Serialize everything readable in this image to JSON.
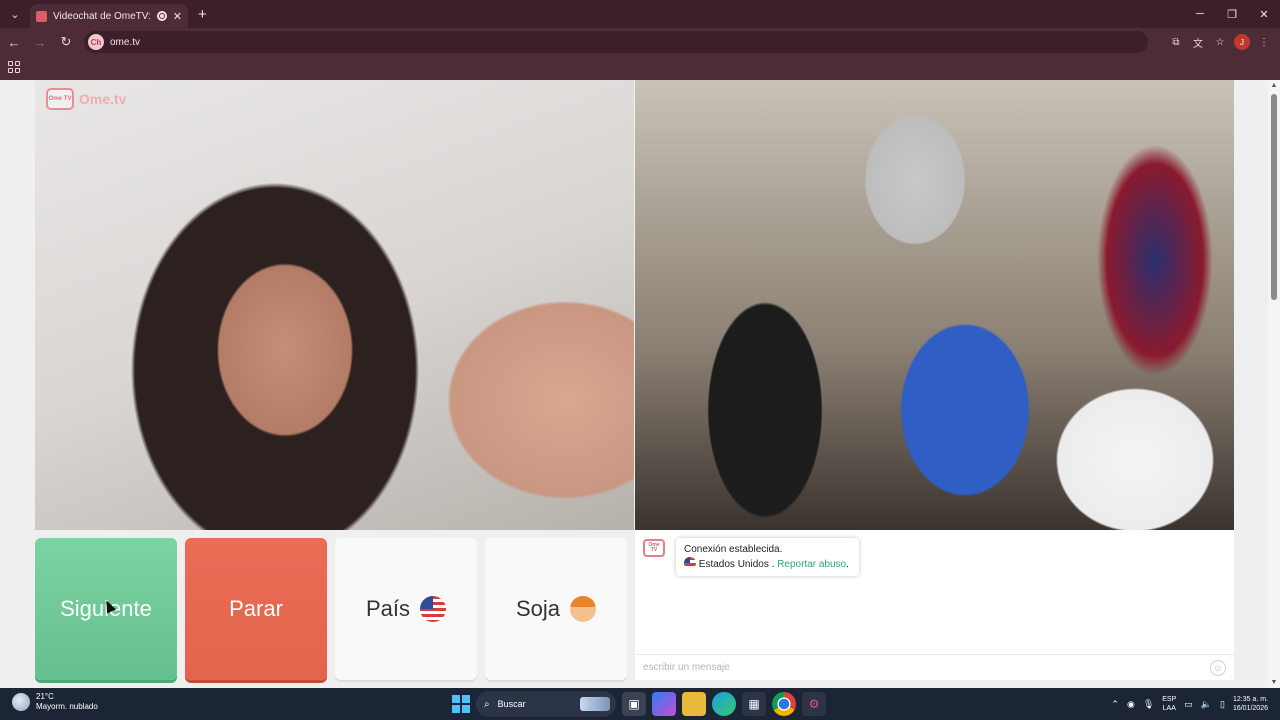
{
  "browser": {
    "tab_title": "Videochat de OmeTV: una",
    "url": "ome.tv",
    "profile_initial": "J",
    "site_chip": "Ch"
  },
  "site": {
    "logo_box": "Ome TV",
    "logo_text": "Ome.tv"
  },
  "controls": {
    "next_label": "Siguiente",
    "stop_label": "Parar",
    "country_label": "País",
    "country_flag": "us-flag",
    "gender_label": "Soja",
    "gender_icon": "boy-avatar"
  },
  "chat": {
    "system_line1": "Conexión establecida.",
    "country": "Estados Unidos",
    "separator": ".",
    "report_link": "Reportar abuso",
    "report_end": ".",
    "input_placeholder": "escribir un mensaje"
  },
  "taskbar": {
    "temperature": "21°C",
    "weather": "Mayorm. nublado",
    "search_label": "Buscar",
    "lang_top": "ESP",
    "lang_bottom": "LAA",
    "time": "12:35 a. m.",
    "date": "16/01/2026"
  },
  "colors": {
    "next": "#6ec896",
    "stop": "#e8664f",
    "chrome_dark": "#3c1f2a",
    "chrome": "#4d2c38",
    "report_link": "#2aa876",
    "taskbar": "#1c2536"
  }
}
